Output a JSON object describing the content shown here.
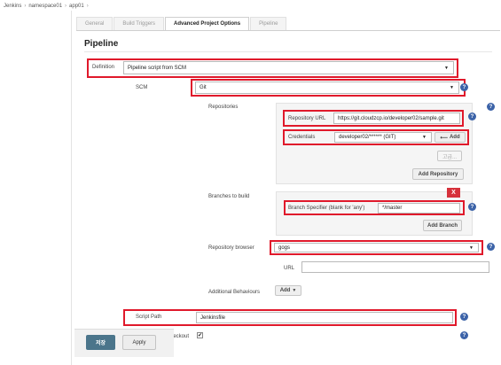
{
  "breadcrumbs": [
    "Jenkins",
    "namespace01",
    "app01"
  ],
  "tabs": [
    {
      "label": "General"
    },
    {
      "label": "Build Triggers"
    },
    {
      "label": "Advanced Project Options"
    },
    {
      "label": "Pipeline"
    }
  ],
  "section_title": "Pipeline",
  "definition": {
    "label": "Definition",
    "value": "Pipeline script from SCM"
  },
  "scm": {
    "label": "SCM",
    "value": "Git"
  },
  "repositories": {
    "label": "Repositories",
    "repo_url_label": "Repository URL",
    "repo_url_value": "https://git.cloudzcp.io/developer02/sample.git",
    "credentials_label": "Credentials",
    "credentials_value": "developer02/****** (GIT)",
    "add_label": "Add",
    "advanced_label": "고급...",
    "add_repository_label": "Add Repository"
  },
  "branches": {
    "label": "Branches to build",
    "delete_label": "X",
    "specifier_label": "Branch Specifier (blank for 'any')",
    "specifier_value": "*/master",
    "add_branch_label": "Add Branch"
  },
  "repo_browser": {
    "label": "Repository browser",
    "value": "gogs",
    "url_label": "URL",
    "url_value": ""
  },
  "additional_behaviours": {
    "label": "Additional Behaviours",
    "add_label": "Add"
  },
  "script_path": {
    "label": "Script Path",
    "value": "Jenkinsfile"
  },
  "lightweight_checkout": {
    "label": "checkout",
    "checked": true,
    "check_glyph": "✔"
  },
  "footer": {
    "save_label": "저장",
    "apply_label": "Apply"
  },
  "colors": {
    "highlight": "#e0192b",
    "help_icon": "#3c63a8",
    "save_button": "#4b758b",
    "delete_button": "#d6313b"
  }
}
